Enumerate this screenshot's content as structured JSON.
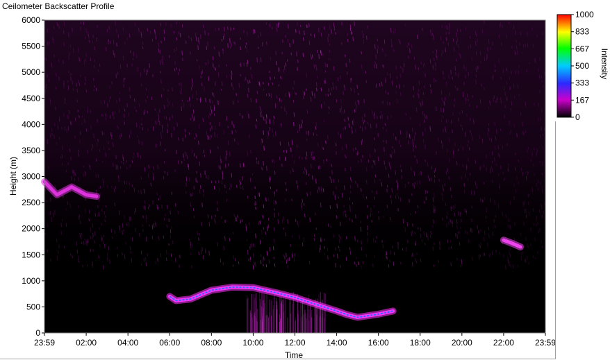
{
  "window": {
    "title": "Ceilometer Backscatter Profile"
  },
  "chart_data": {
    "type": "heatmap",
    "title": "Ceilometer Backscatter Profile",
    "xlabel": "Time",
    "ylabel": "Height (m)",
    "x_ticks": [
      "23:59",
      "02:00",
      "04:00",
      "06:00",
      "08:00",
      "10:00",
      "12:00",
      "14:00",
      "16:00",
      "18:00",
      "20:00",
      "22:00",
      "23:59"
    ],
    "y_ticks": [
      0,
      500,
      1000,
      1500,
      2000,
      2500,
      3000,
      3500,
      4000,
      4500,
      5000,
      5500,
      6000
    ],
    "ylim": [
      0,
      6000
    ],
    "colorbar": {
      "label": "Intensity",
      "ticks": [
        1000,
        833,
        667,
        500,
        333,
        167,
        0
      ],
      "range": [
        0,
        1000
      ],
      "colors": [
        "#000000",
        "#cc00cc",
        "#0000ff",
        "#00ccff",
        "#00ff00",
        "#ffff00",
        "#ff0000"
      ]
    },
    "background_color": "#000000",
    "grid": false,
    "layers": [
      {
        "name": "boundary-layer",
        "color": "#ff33ff",
        "points": [
          [
            6.0,
            700
          ],
          [
            6.3,
            620
          ],
          [
            7.0,
            650
          ],
          [
            8.0,
            820
          ],
          [
            9.0,
            880
          ],
          [
            10.0,
            870
          ],
          [
            11.0,
            780
          ],
          [
            12.0,
            680
          ],
          [
            13.0,
            550
          ],
          [
            14.0,
            420
          ],
          [
            14.5,
            350
          ],
          [
            15.0,
            300
          ],
          [
            15.5,
            330
          ],
          [
            16.0,
            360
          ],
          [
            16.7,
            420
          ]
        ]
      },
      {
        "name": "high-cloud-early",
        "color": "#dd33dd",
        "points": [
          [
            0.0,
            2900
          ],
          [
            0.6,
            2650
          ],
          [
            1.3,
            2800
          ],
          [
            2.0,
            2650
          ],
          [
            2.5,
            2620
          ]
        ]
      },
      {
        "name": "evening-cloud",
        "color": "#ee44ee",
        "points": [
          [
            22.0,
            1780
          ],
          [
            22.4,
            1720
          ],
          [
            22.8,
            1650
          ]
        ]
      }
    ]
  }
}
